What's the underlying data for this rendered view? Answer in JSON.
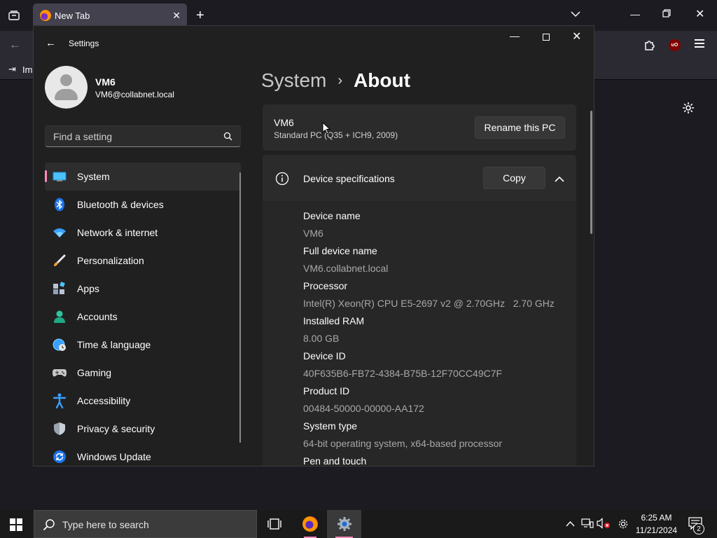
{
  "browser": {
    "tab_title": "New Tab",
    "bookmark_import_label": "Imp",
    "ublock_label": "uO"
  },
  "settings": {
    "window_title": "Settings",
    "user": {
      "name": "VM6",
      "email": "VM6@collabnet.local"
    },
    "search_placeholder": "Find a setting",
    "nav": [
      {
        "label": "System",
        "icon": "system-icon",
        "active": true
      },
      {
        "label": "Bluetooth & devices",
        "icon": "bluetooth-icon"
      },
      {
        "label": "Network & internet",
        "icon": "network-icon"
      },
      {
        "label": "Personalization",
        "icon": "personalization-icon"
      },
      {
        "label": "Apps",
        "icon": "apps-icon"
      },
      {
        "label": "Accounts",
        "icon": "accounts-icon"
      },
      {
        "label": "Time & language",
        "icon": "time-language-icon"
      },
      {
        "label": "Gaming",
        "icon": "gaming-icon"
      },
      {
        "label": "Accessibility",
        "icon": "accessibility-icon"
      },
      {
        "label": "Privacy & security",
        "icon": "privacy-icon"
      },
      {
        "label": "Windows Update",
        "icon": "windows-update-icon"
      }
    ],
    "breadcrumb": {
      "parent": "System",
      "current": "About"
    },
    "pc_card": {
      "name": "VM6",
      "model": "Standard PC (Q35 + ICH9, 2009)",
      "rename_label": "Rename this PC"
    },
    "specs": {
      "title": "Device specifications",
      "copy_label": "Copy",
      "rows": [
        {
          "label": "Device name",
          "value": "VM6"
        },
        {
          "label": "Full device name",
          "value": "VM6.collabnet.local"
        },
        {
          "label": "Processor",
          "value": "Intel(R) Xeon(R) CPU E5-2697 v2 @ 2.70GHz   2.70 GHz"
        },
        {
          "label": "Installed RAM",
          "value": "8.00 GB"
        },
        {
          "label": "Device ID",
          "value": "40F635B6-FB72-4384-B75B-12F70CC49C7F"
        },
        {
          "label": "Product ID",
          "value": "00484-50000-00000-AA172"
        },
        {
          "label": "System type",
          "value": "64-bit operating system, x64-based processor"
        },
        {
          "label": "Pen and touch",
          "value": ""
        }
      ]
    }
  },
  "taskbar": {
    "search_placeholder": "Type here to search",
    "time": "6:25 AM",
    "date": "11/21/2024",
    "notification_count": "2"
  },
  "colors": {
    "accent": "#ff8ab8",
    "settings_bg": "#202020",
    "card_bg": "#2b2b2b"
  }
}
